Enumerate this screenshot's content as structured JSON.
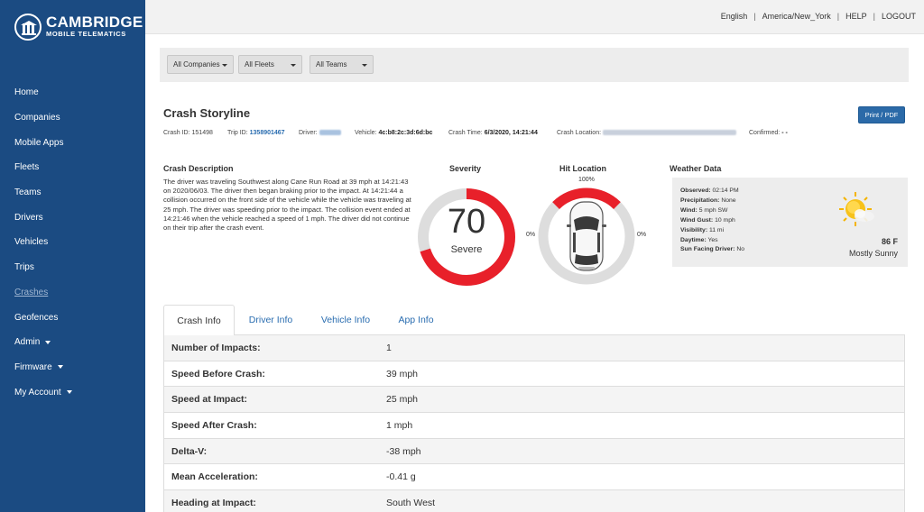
{
  "brand": {
    "line1": "CAMBRIDGE",
    "line2": "MOBILE TELEMATICS"
  },
  "topbar": {
    "language": "English",
    "timezone": "America/New_York",
    "help": "HELP",
    "logout": "LOGOUT"
  },
  "sidebar": {
    "items": [
      {
        "label": "Home",
        "has_caret": false,
        "active": false
      },
      {
        "label": "Companies",
        "has_caret": false,
        "active": false
      },
      {
        "label": "Mobile Apps",
        "has_caret": false,
        "active": false
      },
      {
        "label": "Fleets",
        "has_caret": false,
        "active": false
      },
      {
        "label": "Teams",
        "has_caret": false,
        "active": false
      },
      {
        "label": "Drivers",
        "has_caret": false,
        "active": false
      },
      {
        "label": "Vehicles",
        "has_caret": false,
        "active": false
      },
      {
        "label": "Trips",
        "has_caret": false,
        "active": false
      },
      {
        "label": "Crashes",
        "has_caret": false,
        "active": true
      },
      {
        "label": "Geofences",
        "has_caret": false,
        "active": false
      },
      {
        "label": "Admin",
        "has_caret": true,
        "active": false
      },
      {
        "label": "Firmware",
        "has_caret": true,
        "active": false
      },
      {
        "label": "My Account",
        "has_caret": true,
        "active": false
      }
    ]
  },
  "filters": {
    "companies": "All Companies",
    "fleets": "All Fleets",
    "teams": "All Teams"
  },
  "page": {
    "title": "Crash Storyline",
    "print_label": "Print / PDF",
    "meta": {
      "crash_id_label": "Crash ID:",
      "crash_id": "151498",
      "trip_id_label": "Trip ID:",
      "trip_id": "1358901467",
      "driver_label": "Driver:",
      "vehicle_label": "Vehicle:",
      "vehicle": "4c:b8:2c:3d:6d:bc",
      "crash_time_label": "Crash Time:",
      "crash_time": "6/3/2020, 14:21:44",
      "crash_location_label": "Crash Location:",
      "confirmed_label": "Confirmed:",
      "confirmed": "- -"
    }
  },
  "description": {
    "title": "Crash Description",
    "text": "The driver was traveling Southwest along Cane Run Road at 39 mph at 14:21:43 on 2020/06/03. The driver then began braking prior to the impact. At 14:21:44 a collision occurred on the front side of the vehicle while the vehicle was traveling at 25 mph. The driver was speeding prior to the impact. The collision event ended at 14:21:46 when the vehicle reached a speed of 1 mph. The driver did not continue on their trip after the crash event."
  },
  "severity": {
    "title": "Severity",
    "value": "70",
    "label": "Severe",
    "fraction": 0.7,
    "colors": {
      "fill": "#e8202a",
      "track": "#dddddd"
    }
  },
  "hit_location": {
    "title": "Hit Location",
    "front": "100%",
    "left": "0%",
    "right": "0%",
    "front_fraction": 1.0
  },
  "weather": {
    "title": "Weather Data",
    "rows": [
      {
        "label": "Observed:",
        "value": "02:14 PM"
      },
      {
        "label": "Precipitation:",
        "value": "None"
      },
      {
        "label": "Wind:",
        "value": "5 mph SW"
      },
      {
        "label": "Wind Gust:",
        "value": "10 mph"
      },
      {
        "label": "Visibility:",
        "value": "11 mi"
      },
      {
        "label": "Daytime:",
        "value": "Yes"
      },
      {
        "label": "Sun Facing Driver:",
        "value": "No"
      }
    ],
    "temperature": "86 F",
    "condition": "Mostly Sunny",
    "icon": "sun-cloud-icon"
  },
  "tabs": [
    {
      "label": "Crash Info",
      "active": true
    },
    {
      "label": "Driver Info",
      "active": false
    },
    {
      "label": "Vehicle Info",
      "active": false
    },
    {
      "label": "App Info",
      "active": false
    }
  ],
  "crash_info": [
    {
      "label": "Number of Impacts:",
      "value": "1"
    },
    {
      "label": "Speed Before Crash:",
      "value": "39 mph"
    },
    {
      "label": "Speed at Impact:",
      "value": "25 mph"
    },
    {
      "label": "Speed After Crash:",
      "value": "1 mph"
    },
    {
      "label": "Delta-V:",
      "value": "-38 mph"
    },
    {
      "label": "Mean Acceleration:",
      "value": "-0.41 g"
    },
    {
      "label": "Heading at Impact:",
      "value": "South West"
    }
  ],
  "colors": {
    "sidebar": "#1b4b82",
    "link": "#2a6db0",
    "primary_button": "#2b6aa8"
  }
}
